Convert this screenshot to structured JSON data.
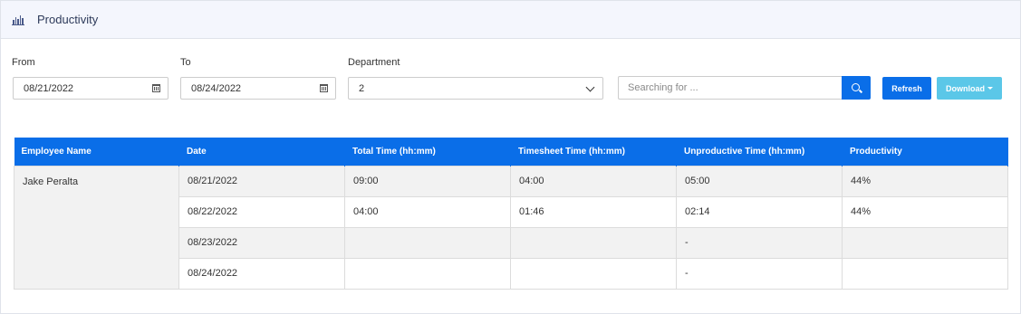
{
  "header": {
    "title": "Productivity",
    "icon": "bar-chart-icon"
  },
  "filters": {
    "from": {
      "label": "From",
      "value": "08/21/2022"
    },
    "to": {
      "label": "To",
      "value": "08/24/2022"
    },
    "department": {
      "label": "Department",
      "value": "2"
    },
    "search": {
      "placeholder": "Searching for ..."
    }
  },
  "buttons": {
    "refresh": "Refresh",
    "download": "Download"
  },
  "colors": {
    "primary": "#0a6ee8",
    "download": "#5bc7e8",
    "header_bg": "#f4f6fd"
  },
  "table": {
    "columns": [
      "Employee Name",
      "Date",
      "Total Time (hh:mm)",
      "Timesheet Time (hh:mm)",
      "Unproductive Time (hh:mm)",
      "Productivity"
    ],
    "employee": "Jake Peralta",
    "rows": [
      {
        "date": "08/21/2022",
        "total": "09:00",
        "timesheet": "04:00",
        "unproductive": "05:00",
        "productivity": "44%"
      },
      {
        "date": "08/22/2022",
        "total": "04:00",
        "timesheet": "01:46",
        "unproductive": "02:14",
        "productivity": "44%"
      },
      {
        "date": "08/23/2022",
        "total": "",
        "timesheet": "",
        "unproductive": "-",
        "productivity": ""
      },
      {
        "date": "08/24/2022",
        "total": "",
        "timesheet": "",
        "unproductive": "-",
        "productivity": ""
      }
    ]
  }
}
